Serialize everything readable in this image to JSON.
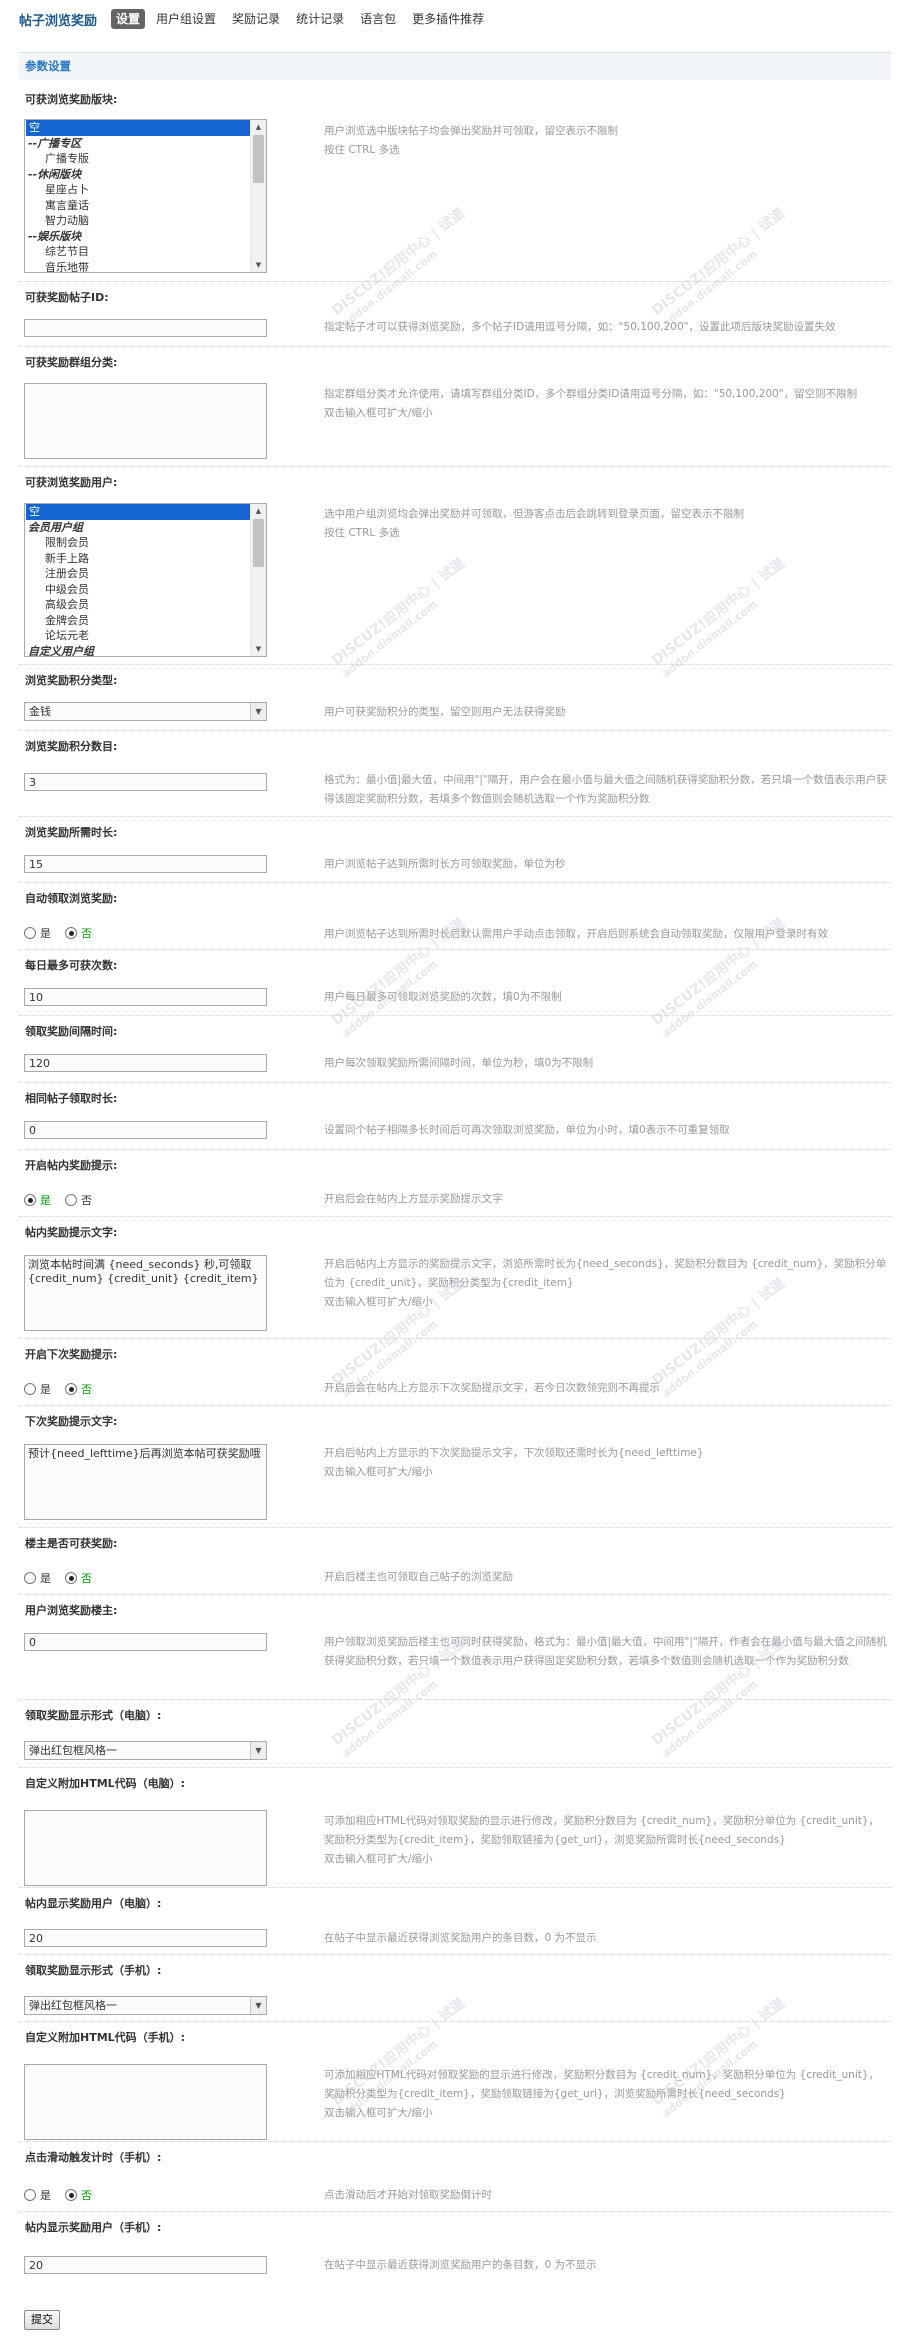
{
  "app_title": "帖子浏览奖励",
  "tabs": [
    "设置",
    "用户组设置",
    "奖励记录",
    "统计记录",
    "语言包",
    "更多插件推荐"
  ],
  "section_title": "参数设置",
  "fields": {
    "forums": {
      "label": "可获浏览奖励版块:",
      "options": [
        {
          "text": "空",
          "kind": "sel"
        },
        {
          "text": "--广播专区",
          "kind": "grp"
        },
        {
          "text": "广播专版",
          "kind": "ind"
        },
        {
          "text": "--休闲版块",
          "kind": "grp"
        },
        {
          "text": "星座占卜",
          "kind": "ind"
        },
        {
          "text": "寓言童话",
          "kind": "ind"
        },
        {
          "text": "智力动脑",
          "kind": "ind"
        },
        {
          "text": "--娱乐版块",
          "kind": "grp"
        },
        {
          "text": "综艺节目",
          "kind": "ind"
        },
        {
          "text": "音乐地带",
          "kind": "ind"
        }
      ],
      "tip": [
        "用户浏览选中版块帖子均会弹出奖励并可领取，留空表示不限制",
        "按住 CTRL 多选"
      ]
    },
    "thread_ids": {
      "label": "可获奖励帖子ID:",
      "value": "",
      "tip": [
        "指定帖子才可以获得浏览奖励，多个帖子ID请用逗号分隔，如：\"50,100,200\"，设置此项后版块奖励设置失效"
      ]
    },
    "group_types": {
      "label": "可获奖励群组分类:",
      "value": "",
      "tip": [
        "指定群组分类才允许使用，请填写群组分类ID，多个群组分类ID请用逗号分隔，如：\"50,100,200\"，留空则不限制",
        "双击输入框可扩大/缩小"
      ]
    },
    "usergroups": {
      "label": "可获浏览奖励用户:",
      "options": [
        {
          "text": "空",
          "kind": "sel"
        },
        {
          "text": "会员用户组",
          "kind": "grp"
        },
        {
          "text": "限制会员",
          "kind": "ind"
        },
        {
          "text": "新手上路",
          "kind": "ind"
        },
        {
          "text": "注册会员",
          "kind": "ind"
        },
        {
          "text": "中级会员",
          "kind": "ind"
        },
        {
          "text": "高级会员",
          "kind": "ind"
        },
        {
          "text": "金牌会员",
          "kind": "ind"
        },
        {
          "text": "论坛元老",
          "kind": "ind"
        },
        {
          "text": "自定义用户组",
          "kind": "grp"
        }
      ],
      "tip": [
        "选中用户组浏览均会弹出奖励并可领取，但游客点击后会跳转到登录页面，留空表示不限制",
        "按住 CTRL 多选"
      ]
    },
    "credit_type": {
      "label": "浏览奖励积分类型:",
      "value": "金钱",
      "tip": [
        "用户可获奖励积分的类型，留空则用户无法获得奖励"
      ]
    },
    "credit_num": {
      "label": "浏览奖励积分数目:",
      "value": "3",
      "tip": [
        "格式为：最小值|最大值，中间用\"|\"隔开，用户会在最小值与最大值之间随机获得奖励积分数，若只填一个数值表示用户获得该固定奖励积分数，若填多个数值则会随机选取一个作为奖励积分数"
      ]
    },
    "need_seconds": {
      "label": "浏览奖励所需时长:",
      "value": "15",
      "tip": [
        "用户浏览帖子达到所需时长方可领取奖励，单位为秒"
      ]
    },
    "auto_receive": {
      "label": "自动领取浏览奖励:",
      "yes": "是",
      "no": "否",
      "selected": "no",
      "tip": [
        "用户浏览帖子达到所需时长后默认需用户手动点击领取，开启后则系统会自动领取奖励，仅限用户登录时有效"
      ]
    },
    "daily_max": {
      "label": "每日最多可获次数:",
      "value": "10",
      "tip": [
        "用户每日最多可领取浏览奖励的次数，填0为不限制"
      ]
    },
    "interval": {
      "label": "领取奖励间隔时间:",
      "value": "120",
      "tip": [
        "用户每次领取奖励所需间隔时间，单位为秒，填0为不限制"
      ]
    },
    "same_thread": {
      "label": "相同帖子领取时长:",
      "value": "0",
      "tip": [
        "设置同个帖子相隔多长时间后可再次领取浏览奖励，单位为小时，填0表示不可重复领取"
      ]
    },
    "inpost_tip": {
      "label": "开启帖内奖励提示:",
      "yes": "是",
      "no": "否",
      "selected": "yes",
      "tip": [
        "开启后会在帖内上方显示奖励提示文字"
      ]
    },
    "inpost_text": {
      "label": "帖内奖励提示文字:",
      "value": "浏览本帖时间满 {need_seconds} 秒,可领取 {credit_num} {credit_unit} {credit_item}",
      "tip": [
        "开启后帖内上方显示的奖励提示文字，浏览所需时长为{need_seconds}，奖励积分数目为 {credit_num}，奖励积分单位为 {credit_unit}，奖励积分类型为{credit_item}",
        "双击输入框可扩大/缩小"
      ]
    },
    "next_tip": {
      "label": "开启下次奖励提示:",
      "yes": "是",
      "no": "否",
      "selected": "no",
      "tip": [
        "开启后会在帖内上方显示下次奖励提示文字，若今日次数领完则不再提示"
      ]
    },
    "next_text": {
      "label": "下次奖励提示文字:",
      "value": "预计{need_lefttime}后再浏览本帖可获奖励哦",
      "tip": [
        "开启后帖内上方显示的下次奖励提示文字，下次领取还需时长为{need_lefttime}",
        "双击输入框可扩大/缩小"
      ]
    },
    "author_reward": {
      "label": "楼主是否可获奖励:",
      "yes": "是",
      "no": "否",
      "selected": "no",
      "tip": [
        "开启后楼主也可领取自己帖子的浏览奖励"
      ]
    },
    "author_credit": {
      "label": "用户浏览奖励楼主:",
      "value": "0",
      "tip": [
        "用户领取浏览奖励后楼主也可同时获得奖励，格式为：最小值|最大值，中间用\"|\"隔开，作者会在最小值与最大值之间随机获得奖励积分数，若只填一个数值表示用户获得固定奖励积分数，若填多个数值则会随机选取一个作为奖励积分数"
      ]
    },
    "pc_style": {
      "label": "领取奖励显示形式（电脑）:",
      "value": "弹出红包框风格一"
    },
    "pc_html": {
      "label": "自定义附加HTML代码（电脑）:",
      "value": "",
      "tip": [
        "可添加相应HTML代码对领取奖励的显示进行修改，奖励积分数目为 {credit_num}，奖励积分单位为 {credit_unit}，奖励积分类型为{credit_item}，奖励领取链接为{get_url}，浏览奖励所需时长{need_seconds}",
        "双击输入框可扩大/缩小"
      ]
    },
    "pc_users": {
      "label": "帖内显示奖励用户（电脑）:",
      "value": "20",
      "tip": [
        "在帖子中显示最近获得浏览奖励用户的条目数，0 为不显示"
      ]
    },
    "m_style": {
      "label": "领取奖励显示形式（手机）:",
      "value": "弹出红包框风格一"
    },
    "m_html": {
      "label": "自定义附加HTML代码（手机）:",
      "value": "",
      "tip": [
        "可添加相应HTML代码对领取奖励的显示进行修改，奖励积分数目为 {credit_num}，奖励积分单位为 {credit_unit}，奖励积分类型为{credit_item}，奖励领取链接为{get_url}，浏览奖励所需时长{need_seconds}",
        "双击输入框可扩大/缩小"
      ]
    },
    "m_slide": {
      "label": "点击滑动触发计时（手机）:",
      "yes": "是",
      "no": "否",
      "selected": "no",
      "tip": [
        "点击滑动后才开始对领取奖励倒计时"
      ]
    },
    "m_users": {
      "label": "帖内显示奖励用户（手机）:",
      "value": "20",
      "tip": [
        "在帖子中显示最近获得浏览奖励用户的条目数，0 为不显示"
      ]
    }
  },
  "submit_label": "提交",
  "watermark": [
    "DISCUZ!应用中心 | 试道",
    "addon.dismall.com"
  ]
}
